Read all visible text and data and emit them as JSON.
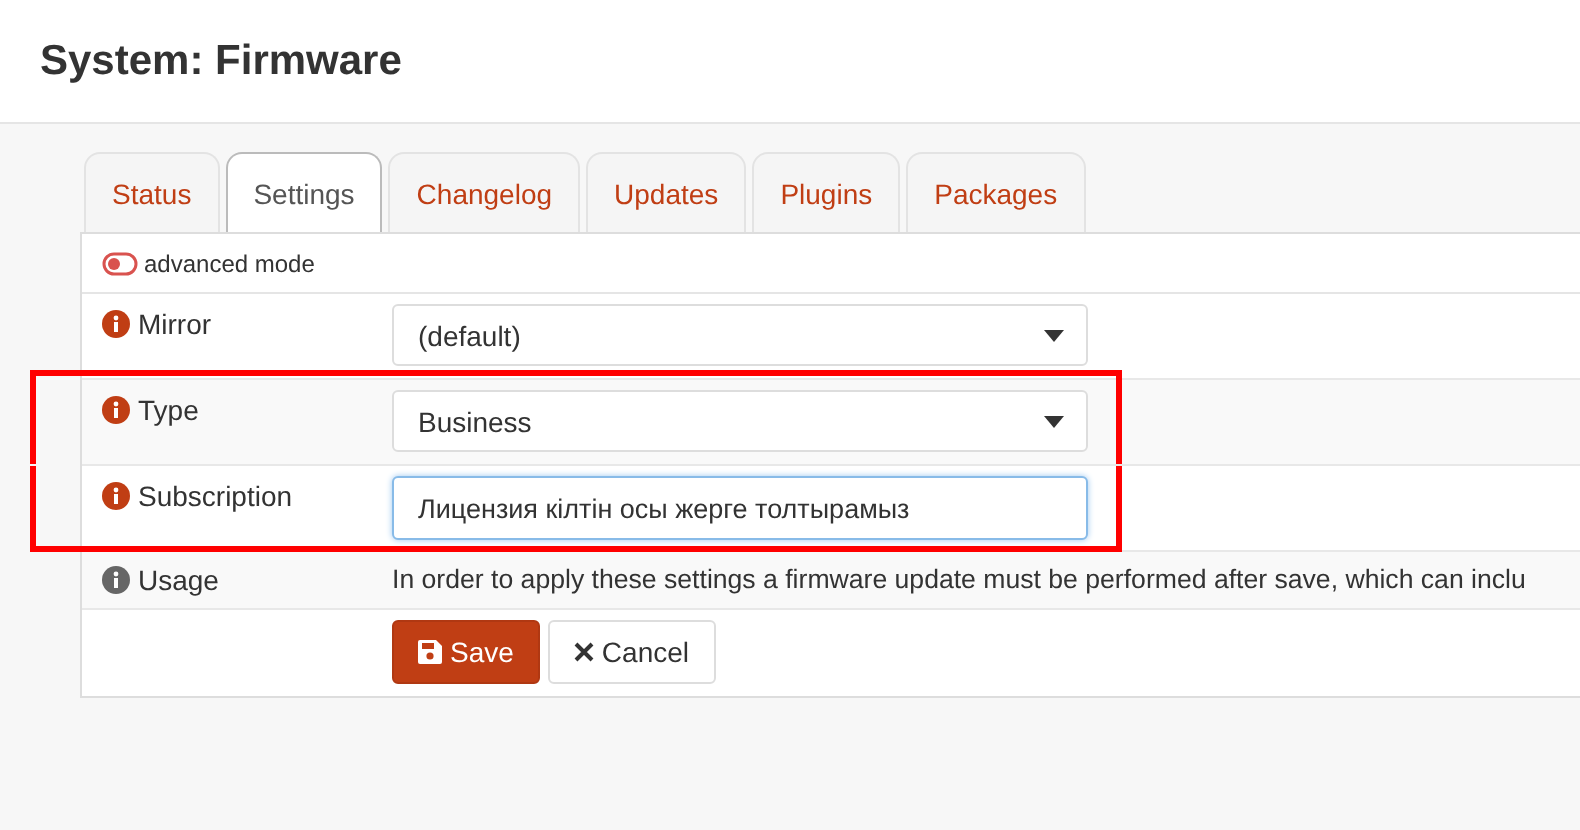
{
  "page": {
    "title": "System: Firmware"
  },
  "tabs": [
    {
      "label": "Status",
      "selected": false
    },
    {
      "label": "Settings",
      "selected": true
    },
    {
      "label": "Changelog",
      "selected": false
    },
    {
      "label": "Updates",
      "selected": false
    },
    {
      "label": "Plugins",
      "selected": false
    },
    {
      "label": "Packages",
      "selected": false
    }
  ],
  "advanced_mode": {
    "label": "advanced mode",
    "on": false
  },
  "rows": [
    {
      "label": "Mirror",
      "kind": "select",
      "value": "(default)",
      "highlighted": false
    },
    {
      "label": "Type",
      "kind": "select",
      "value": "Business",
      "highlighted": true
    },
    {
      "label": "Subscription",
      "kind": "input",
      "value": "Лицензия кілтін осы жерге толтырамыз",
      "highlighted": true
    },
    {
      "label": "Usage",
      "kind": "text",
      "value": "In order to apply these settings a firmware update must be performed after save, which can inclu",
      "highlighted": false
    }
  ],
  "buttons": [
    {
      "label": "Save",
      "kind": "primary"
    },
    {
      "label": "Cancel",
      "kind": "cancel"
    }
  ]
}
